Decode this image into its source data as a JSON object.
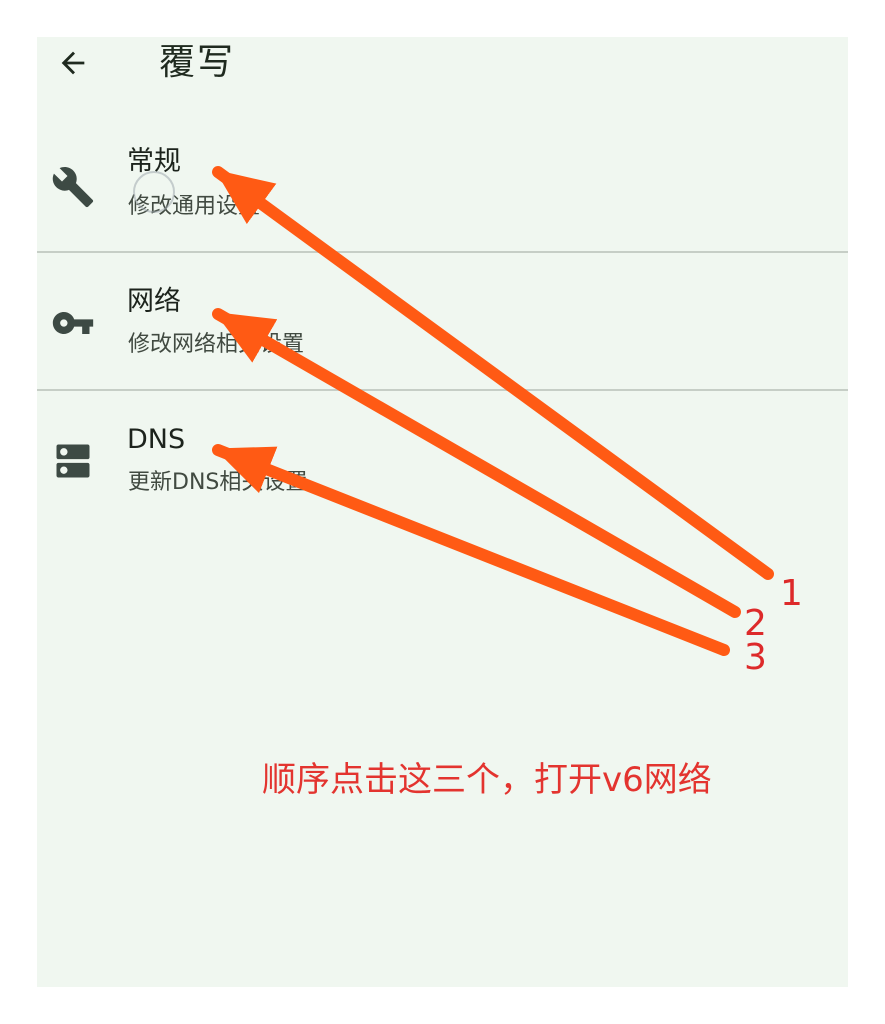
{
  "header": {
    "title": "覆写",
    "back_icon": "arrow-left-icon"
  },
  "settings": {
    "items": [
      {
        "label": "常规",
        "description": "修改通用设置",
        "icon": "wrench-icon"
      },
      {
        "label": "网络",
        "description": "修改网络相关设置",
        "icon": "key-icon"
      },
      {
        "label": "DNS",
        "description": "更新DNS相关设置",
        "icon": "dns-server-icon"
      }
    ]
  },
  "annotation": {
    "markers": [
      "1",
      "2",
      "3"
    ],
    "instruction": "顺序点击这三个，打开v6网络",
    "arrow_color": "#ff5a14",
    "text_color": "#e3342f"
  },
  "colors": {
    "background": "#f0f7f0",
    "icon": "#3d4a44",
    "divider": "#c6cec6"
  }
}
